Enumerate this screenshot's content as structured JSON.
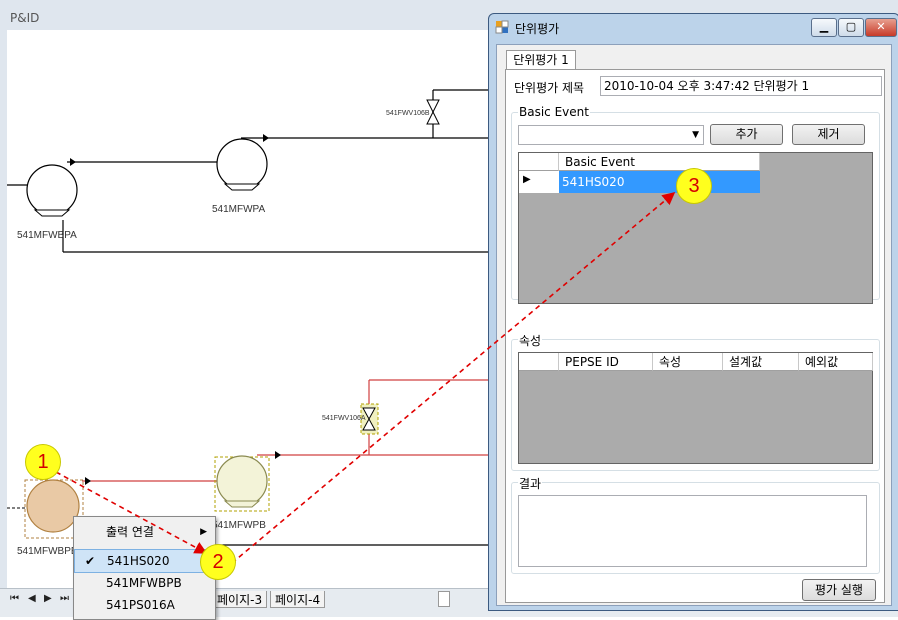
{
  "pid": {
    "title": "P&ID",
    "pumps": [
      "541MFWBPA",
      "541MFWPA",
      "541MFWBPB",
      "541MFWPB"
    ],
    "valves": [
      "541FWV106B",
      "541FWV106A"
    ],
    "page_tabs": [
      "페이지-3",
      "페이지-4"
    ]
  },
  "context_menu": {
    "items": [
      {
        "label": "출력 연결",
        "submenu": true
      },
      {
        "label": "541HS020",
        "checked": true
      },
      {
        "label": "541MFWBPB"
      },
      {
        "label": "541PS016A"
      }
    ]
  },
  "dialog": {
    "title": "단위평가",
    "tab": "단위평가 1",
    "title_label": "단위평가 제목",
    "title_value": "2010-10-04 오후 3:47:42 단위평가 1",
    "basic_event_group": "Basic Event",
    "add_button": "추가",
    "remove_button": "제거",
    "basic_event_column": "Basic Event",
    "basic_event_rows": [
      "541HS020"
    ],
    "attr_group": "속성",
    "attr_columns": [
      "PEPSE ID",
      "속성",
      "설계값",
      "예외값"
    ],
    "result_group": "결과",
    "run_button": "평가 실행"
  },
  "annotations": [
    "1",
    "2",
    "3"
  ],
  "colors": {
    "annotation_arrow": "#e00000",
    "badge": "#ffff1e",
    "selection": "#3399ff"
  }
}
